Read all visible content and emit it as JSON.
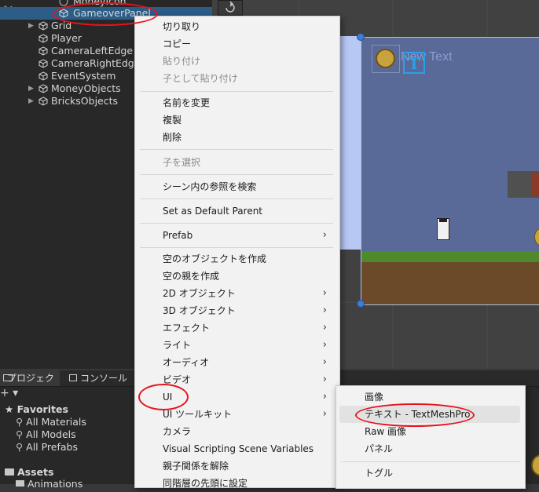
{
  "hierarchy": {
    "partial_top_item": "MoneyIcon",
    "selected_item": "GameoverPanel",
    "items": [
      {
        "label": "Grid",
        "expandable": true
      },
      {
        "label": "Player",
        "expandable": false
      },
      {
        "label": "CameraLeftEdge",
        "expandable": false
      },
      {
        "label": "CameraRightEdge",
        "expandable": false
      },
      {
        "label": "EventSystem",
        "expandable": false
      },
      {
        "label": "MoneyObjects",
        "expandable": true
      },
      {
        "label": "BricksObjects",
        "expandable": true
      }
    ]
  },
  "scene": {
    "new_text_label": "New Text",
    "text_icon_glyph": "T"
  },
  "bottom_tabs": {
    "project": "プロジェクト",
    "console": "コンソール"
  },
  "project_panel": {
    "favorites_label": "Favorites",
    "favorites": [
      "All Materials",
      "All Models",
      "All Prefabs"
    ],
    "assets_label": "Assets",
    "assets_child": "Animations"
  },
  "context_menu": {
    "group1": [
      {
        "label": "切り取り",
        "disabled": false
      },
      {
        "label": "コピー",
        "disabled": false
      },
      {
        "label": "貼り付け",
        "disabled": true
      },
      {
        "label": "子として貼り付け",
        "disabled": true
      }
    ],
    "group2": [
      {
        "label": "名前を変更",
        "disabled": false
      },
      {
        "label": "複製",
        "disabled": false
      },
      {
        "label": "削除",
        "disabled": false
      }
    ],
    "select_children": "子を選択",
    "find_refs": "シーン内の参照を検索",
    "set_default_parent": "Set as Default Parent",
    "prefab": "Prefab",
    "group3": [
      {
        "label": "空のオブジェクトを作成",
        "submenu": false
      },
      {
        "label": "空の親を作成",
        "submenu": false
      },
      {
        "label": "2D オブジェクト",
        "submenu": true
      },
      {
        "label": "3D オブジェクト",
        "submenu": true
      },
      {
        "label": "エフェクト",
        "submenu": true
      },
      {
        "label": "ライト",
        "submenu": true
      },
      {
        "label": "オーディオ",
        "submenu": true
      },
      {
        "label": "ビデオ",
        "submenu": true
      },
      {
        "label": "UI",
        "submenu": true
      },
      {
        "label": "UI ツールキット",
        "submenu": true
      },
      {
        "label": "カメラ",
        "submenu": false
      },
      {
        "label": "Visual Scripting Scene Variables",
        "submenu": false
      },
      {
        "label": "親子関係を解除",
        "submenu": false
      },
      {
        "label": "同階層の先頭に設定",
        "submenu": false
      }
    ],
    "chevron_glyph": "›"
  },
  "ui_submenu": {
    "items": [
      "画像",
      "テキスト - TextMeshPro",
      "Raw 画像",
      "パネル"
    ],
    "highlighted_index": 1,
    "after_separator": "トグル"
  },
  "colors": {
    "selection": "#2c5d87",
    "annotation_red": "#e8121c",
    "menu_bg": "#f2f2f2",
    "canvas_panel": "#5a6a98"
  }
}
